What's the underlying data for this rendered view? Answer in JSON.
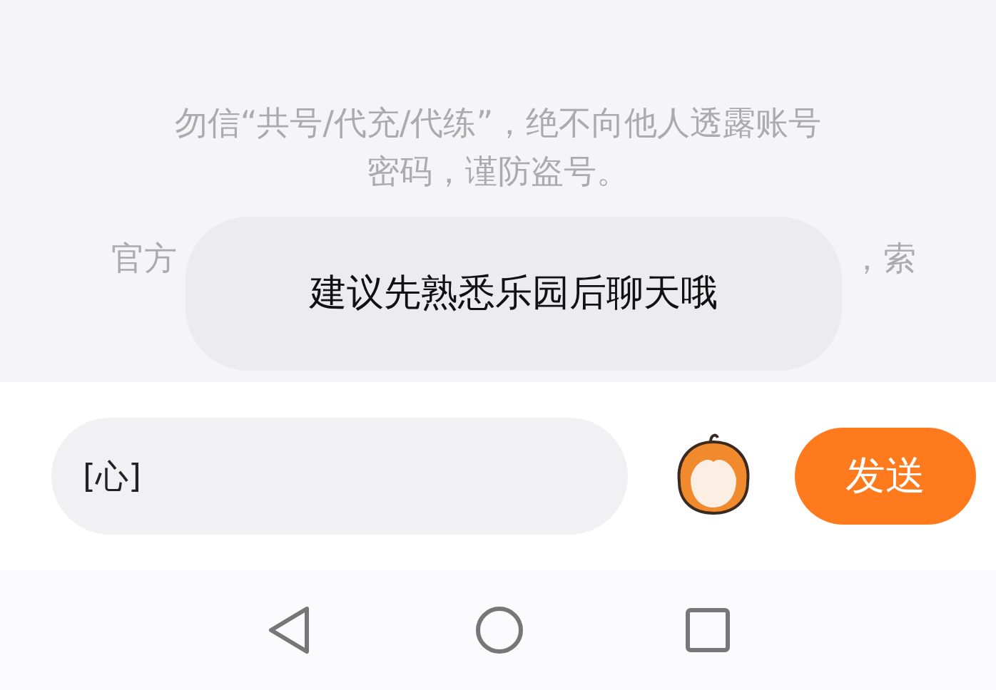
{
  "notice": {
    "lines": [
      "勿信“共号/代充/代练”，绝不向他人透露账号",
      "密码，谨防盗号。"
    ],
    "partial_line": {
      "left": "官方",
      "right": "，索"
    }
  },
  "toast": {
    "text": "建议先熟悉乐园后聊天哦"
  },
  "composer": {
    "value": "[心]",
    "send_label": "发送"
  }
}
